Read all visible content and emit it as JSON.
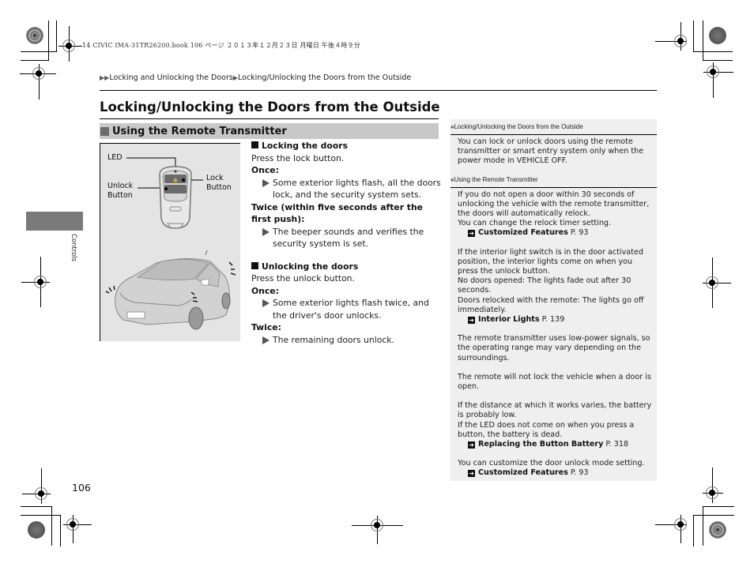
{
  "print_header": "14 CIVIC IMA-31TR26200.book  106 ページ  ２０１３年１２月２３日  月曜日  午後４時９分",
  "breadcrumb": {
    "items": [
      "Locking and Unlocking the Doors",
      "Locking/Unlocking the Doors from the Outside"
    ]
  },
  "page_title": "Locking/Unlocking the Doors from the Outside",
  "section": {
    "title": "Using the Remote Transmitter"
  },
  "side_tab": {
    "label": "Controls"
  },
  "figure": {
    "labels": {
      "led": "LED",
      "unlock_button": "Unlock Button",
      "unlock_line1": "Unlock",
      "unlock_line2": "Button",
      "lock_line1": "Lock",
      "lock_line2": "Button"
    }
  },
  "locking": {
    "heading": "Locking the doors",
    "instruction": "Press the lock button.",
    "once_label": "Once:",
    "once_text": "Some exterior lights flash, all the doors lock, and the security system sets.",
    "twice_label": "Twice (within five seconds after the first push):",
    "twice_text": "The beeper sounds and verifies the security system is set."
  },
  "unlocking": {
    "heading": "Unlocking the doors",
    "instruction": "Press the unlock button.",
    "once_label": "Once:",
    "once_text": "Some exterior lights flash twice, and the driver's door unlocks.",
    "twice_label": "Twice:",
    "twice_text": "The remaining doors unlock."
  },
  "notes": {
    "note1": {
      "heading": "Locking/Unlocking the Doors from the Outside",
      "text": "You can lock or unlock doors using the remote transmitter or smart entry system only when the power mode in VEHICLE OFF."
    },
    "note2": {
      "heading": "Using the Remote Transmitter",
      "p1": "If you do not open a door within 30 seconds of unlocking the vehicle with the remote transmitter, the doors will automatically relock.",
      "p1b": "You can change the relock timer setting.",
      "xref1": {
        "title": "Customized Features",
        "page": "P. 93"
      },
      "p2": "If the interior light switch is in the door activated position, the interior lights come on when you press the unlock button.",
      "p2b": "No doors opened: The lights fade out after 30 seconds.",
      "p2c": "Doors relocked with the remote: The lights go off immediately.",
      "xref2": {
        "title": "Interior Lights",
        "page": "P. 139"
      },
      "p3": "The remote transmitter uses low-power signals, so the operating range may vary depending on the surroundings.",
      "p4": "The remote will not lock the vehicle when a door is open.",
      "p5": "If the distance at which it works varies, the battery is probably low.",
      "p5b": "If the LED does not come on when you press a button, the battery is dead.",
      "xref3": {
        "title": "Replacing the Button Battery",
        "page": "P. 318"
      },
      "p6": "You can customize the door unlock mode setting.",
      "xref4": {
        "title": "Customized Features",
        "page": "P. 93"
      }
    },
    "heading_icon": "double-chevron-icon",
    "xref_icon": "arrow-right-box-icon"
  },
  "page_number": "106"
}
